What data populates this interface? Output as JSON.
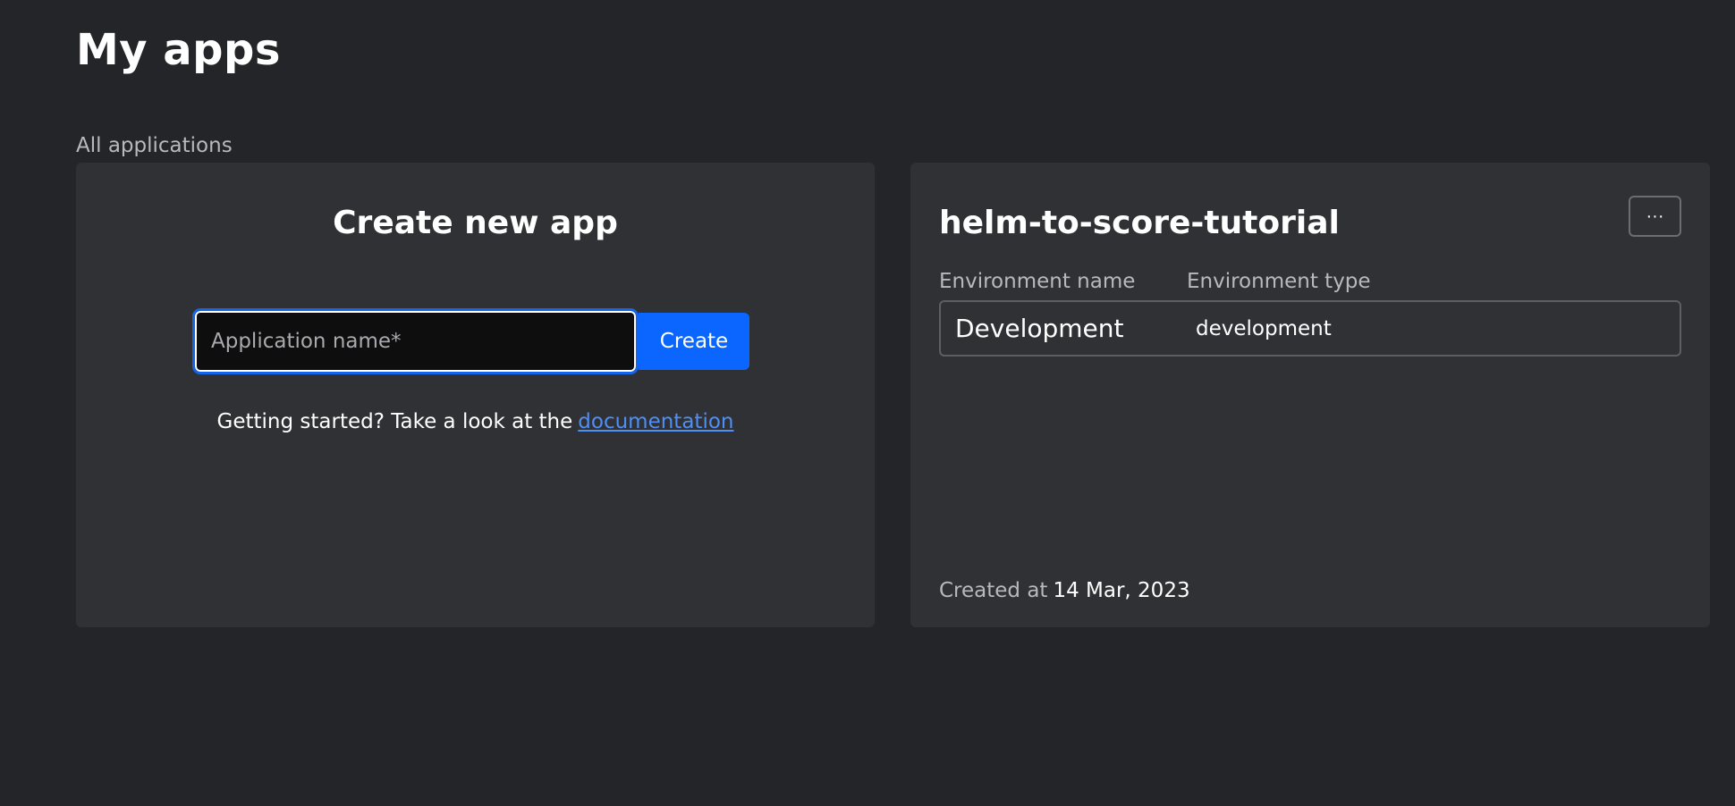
{
  "page": {
    "title": "My apps",
    "section_label": "All applications"
  },
  "create_card": {
    "title": "Create new app",
    "input_placeholder": "Application name*",
    "input_value": "",
    "create_label": "Create",
    "help_text": "Getting started? Take a look at the",
    "help_link": "documentation"
  },
  "apps": [
    {
      "name": "helm-to-score-tutorial",
      "menu_label": "···",
      "env_name_header": "Environment name",
      "env_type_header": "Environment type",
      "environments": [
        {
          "name": "Development",
          "type": "development"
        }
      ],
      "created_label": "Created at",
      "created_value": "14 Mar, 2023"
    }
  ],
  "colors": {
    "background": "#242528",
    "card": "#303135",
    "accent": "#0b66ff",
    "link": "#4f8ff5",
    "muted_text": "#b8b9bd"
  },
  "icons": {
    "menu": "more-horizontal-icon"
  }
}
